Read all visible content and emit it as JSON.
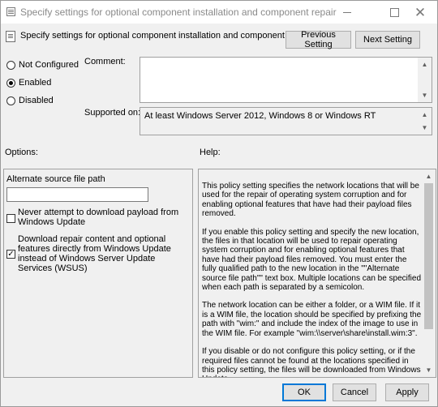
{
  "window": {
    "title": "Specify settings for optional component installation and component repair",
    "controls": {
      "minimize_icon": "minimize-icon",
      "maximize_icon": "maximize-icon",
      "close_icon": "close-icon"
    }
  },
  "header": {
    "policy_name": "Specify settings for optional component installation and component repair",
    "prev_label": "Previous Setting",
    "next_label": "Next Setting"
  },
  "state": {
    "options": [
      {
        "label": "Not Configured",
        "selected": false
      },
      {
        "label": "Enabled",
        "selected": true
      },
      {
        "label": "Disabled",
        "selected": false
      }
    ]
  },
  "comment": {
    "label": "Comment:",
    "value": ""
  },
  "supported": {
    "label": "Supported on:",
    "value": "At least Windows Server 2012, Windows 8 or Windows RT"
  },
  "options_panel": {
    "label": "Options:",
    "alt_source_label": "Alternate source file path",
    "alt_source_value": "",
    "never_download_label": "Never attempt to download payload from Windows Update",
    "never_download_checked": false,
    "direct_download_label": "Download repair content and optional features directly from Windows Update instead of Windows Server Update Services (WSUS)",
    "direct_download_checked": true
  },
  "help_panel": {
    "label": "Help:",
    "paragraphs": [
      "This policy setting specifies the network locations that will be used for the repair of operating system corruption and for enabling optional features that have had their payload files removed.",
      "If you enable this policy setting and specify the new location, the files in that location will be used to repair operating system corruption and for enabling optional features that have had their payload files removed. You must enter the fully qualified path to the new location in the \"\"Alternate source file path\"\" text box. Multiple locations can be specified when each path is separated by a semicolon.",
      "The network location can be either a folder, or a WIM file. If it is a WIM file, the location should be specified by prefixing the path with \"wim:\" and include the index of the image to use in the WIM file. For example \"wim:\\\\server\\share\\install.wim:3\".",
      "If you disable or do not configure this policy setting, or if the required files cannot be found at the locations specified in this policy setting, the files will be downloaded from Windows Update"
    ]
  },
  "footer": {
    "ok_label": "OK",
    "cancel_label": "Cancel",
    "apply_label": "Apply"
  },
  "colors": {
    "accent": "#0078d7",
    "window_bg": "#f0f0f0"
  }
}
